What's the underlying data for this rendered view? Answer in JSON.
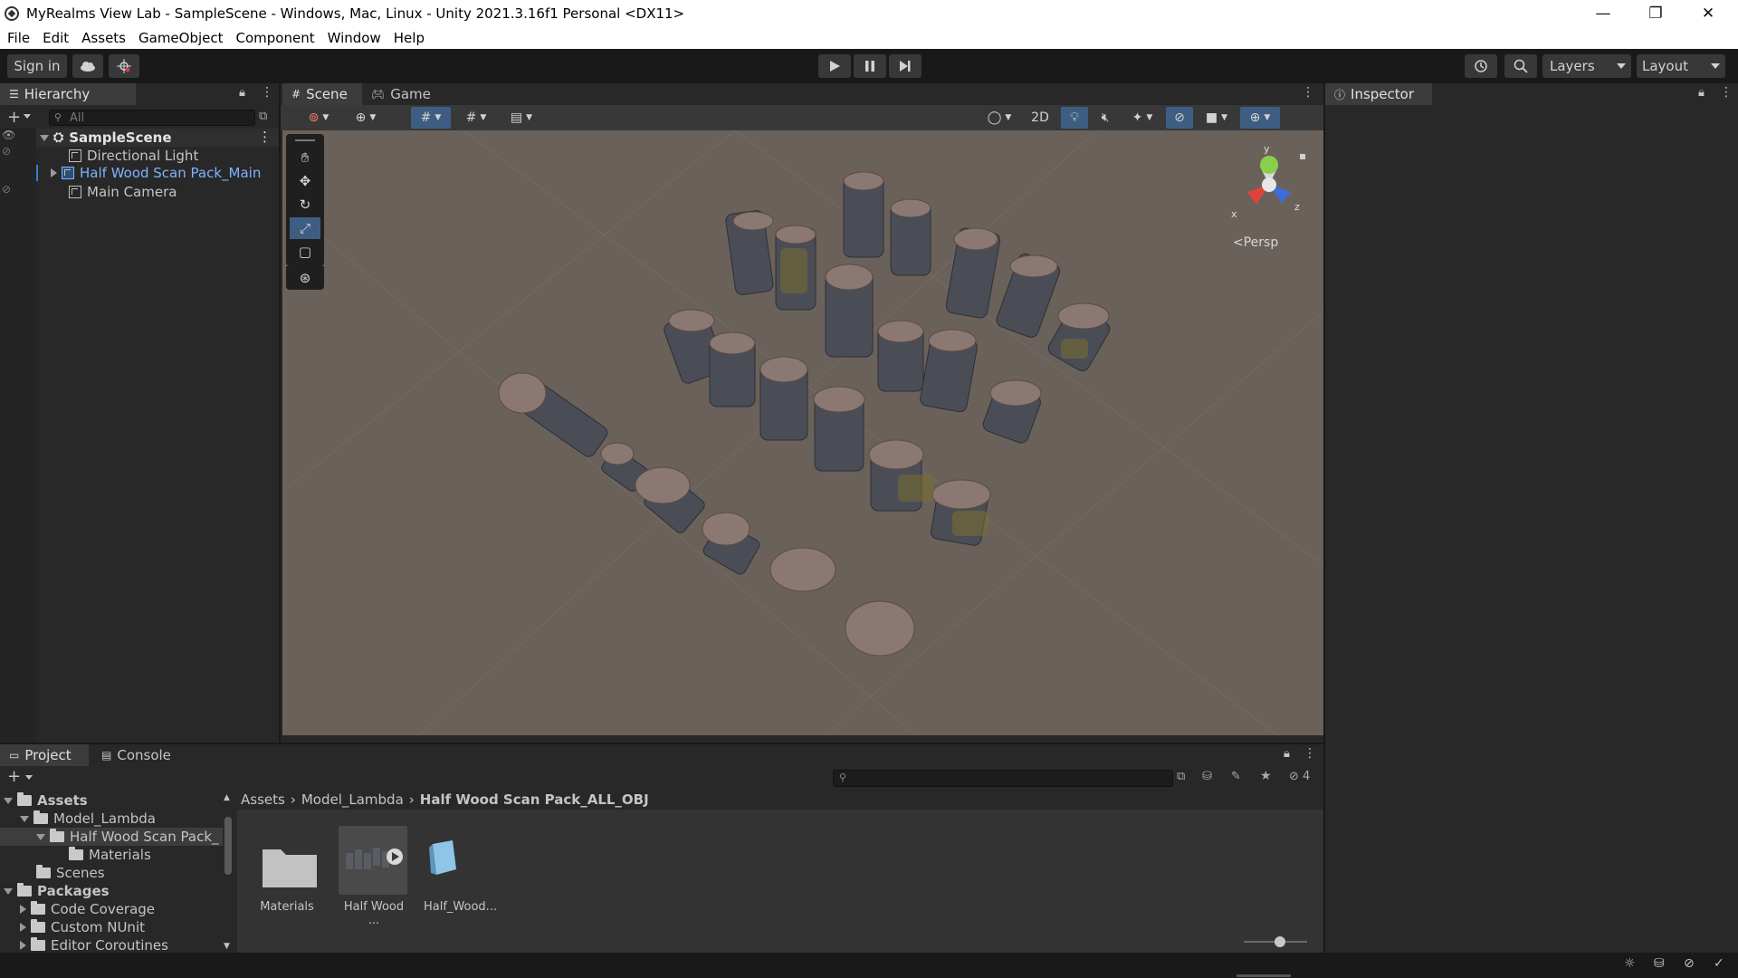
{
  "window": {
    "title": "MyRealms View Lab - SampleScene - Windows, Mac, Linux - Unity 2021.3.16f1 Personal <DX11>",
    "minimize": "—",
    "restore": "❐",
    "close": "✕"
  },
  "menu": [
    "File",
    "Edit",
    "Assets",
    "GameObject",
    "Component",
    "Window",
    "Help"
  ],
  "toolbar": {
    "sign_in": "Sign in",
    "layers": "Layers",
    "layout": "Layout"
  },
  "hierarchy": {
    "tab": "Hierarchy",
    "search_placeholder": "All",
    "scene": "SampleScene",
    "items": [
      "Directional Light",
      "Half Wood Scan Pack_Main",
      "Main Camera"
    ]
  },
  "scene_view": {
    "tabs": [
      "Scene",
      "Game"
    ],
    "btn_2d": "2D",
    "gizmo_y": "y",
    "gizmo_x": "x",
    "gizmo_z": "z",
    "persp": "Persp"
  },
  "inspector": {
    "tab": "Inspector"
  },
  "project": {
    "tabs": [
      "Project",
      "Console"
    ],
    "hidden_count": "4",
    "breadcrumb": [
      "Assets",
      "Model_Lambda",
      "Half Wood Scan Pack_ALL_OBJ"
    ],
    "tree": [
      "Assets",
      "Model_Lambda",
      "Half Wood Scan Pack_",
      "Materials",
      "Scenes",
      "Packages",
      "Code Coverage",
      "Custom NUnit",
      "Editor Coroutines"
    ],
    "assets": [
      "Materials",
      "Half Wood ...",
      "Half_Wood..."
    ]
  },
  "colors": {
    "scene_bg": "#6a615b",
    "selected_text": "#7fb2ff",
    "accent_blue": "#3d5e82"
  }
}
